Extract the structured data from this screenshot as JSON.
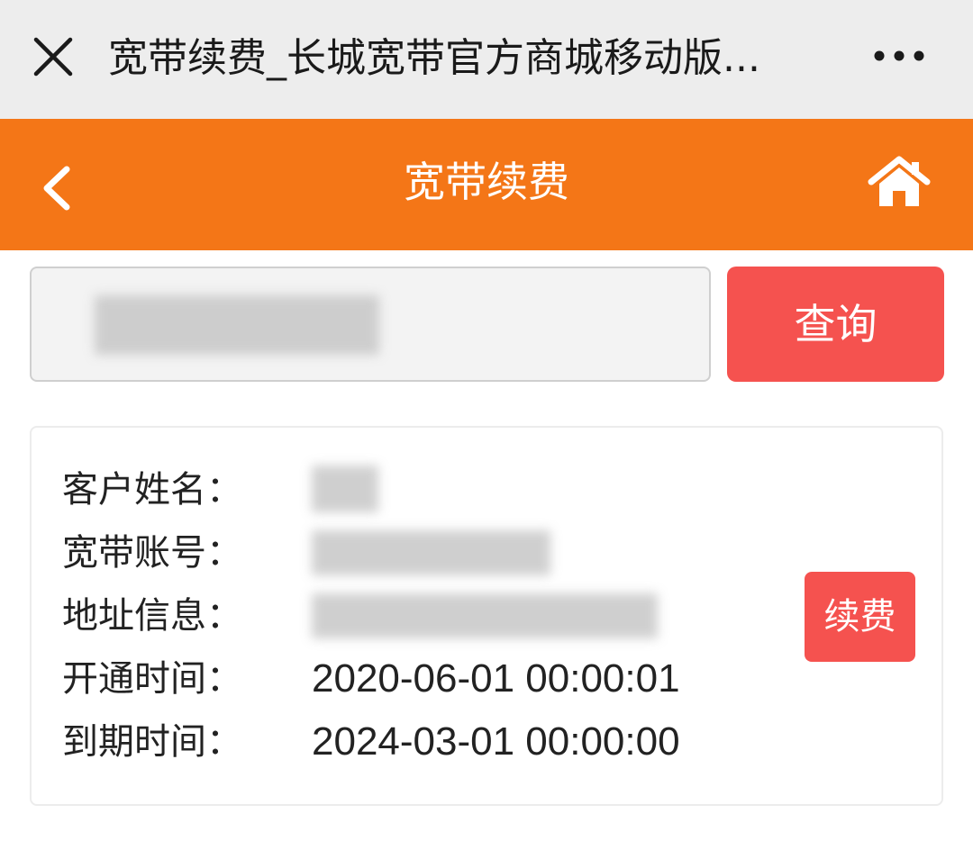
{
  "browser": {
    "page_title": "宽带续费_长城宽带官方商城移动版...",
    "close_icon": "close-icon",
    "more_icon": "more-dots-icon"
  },
  "header": {
    "title": "宽带续费",
    "back_icon": "chevron-left-icon",
    "home_icon": "home-icon",
    "color": "#f47617"
  },
  "search": {
    "value": "",
    "button_label": "查询",
    "button_color": "#f5524f"
  },
  "account": {
    "fields": [
      {
        "label": "客户姓名：",
        "value": ""
      },
      {
        "label": "宽带账号：",
        "value": ""
      },
      {
        "label": "地址信息：",
        "value": ""
      },
      {
        "label": "开通时间：",
        "value": "2020-06-01 00:00:01"
      },
      {
        "label": "到期时间：",
        "value": "2024-03-01 00:00:00"
      }
    ],
    "renew_label": "续费"
  }
}
